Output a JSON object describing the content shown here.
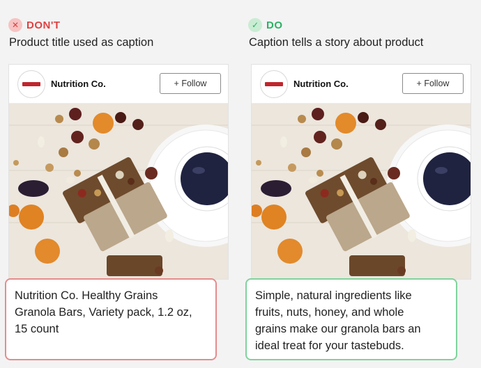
{
  "left": {
    "verdict_icon": "x-icon",
    "verdict_label": "DON'T",
    "subtitle": "Product title used as caption",
    "card": {
      "brand": "Nutrition Co.",
      "follow_label": "+ Follow"
    },
    "caption_lines": [
      "Nutrition Co. Healthy Grains",
      "Granola Bars, Variety pack, 1.2 oz,",
      "15 count"
    ]
  },
  "right": {
    "verdict_icon": "check-icon",
    "verdict_label": "DO",
    "subtitle": "Caption tells a story about product",
    "card": {
      "brand": "Nutrition Co.",
      "follow_label": "+ Follow"
    },
    "caption_lines": [
      "Simple, natural ingredients like",
      "fruits, nuts, honey, and whole",
      "grains make our granola bars an",
      "ideal treat for your tastebuds."
    ]
  },
  "colors": {
    "dont": "#e04141",
    "do": "#2bb164",
    "bad_border": "#e58c8c",
    "good_border": "#7fd39c",
    "brand_logo": "#c0262d"
  }
}
